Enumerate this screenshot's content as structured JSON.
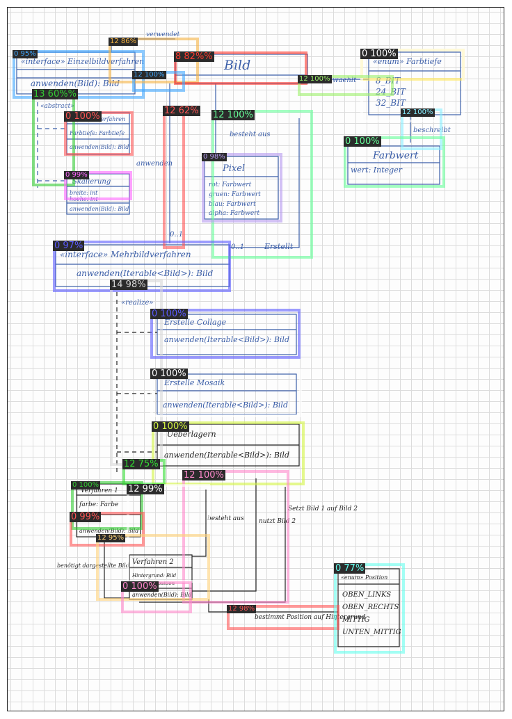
{
  "colors": {
    "ink": "#3b5ea8",
    "pen": "#222222"
  },
  "diagram": {
    "classes": [
      {
        "id": "einzelbild",
        "stereotype": "«interface» Einzelbildverfahren",
        "methods": [
          "anwenden(Bild): Bild"
        ]
      },
      {
        "id": "bild",
        "name": "Bild"
      },
      {
        "id": "farbtiefe",
        "stereotype": "«enum» Farbtiefe",
        "literals": [
          "8_BIT",
          "24_BIT",
          "32_BIT"
        ]
      },
      {
        "id": "farbwert",
        "name": "Farbwert",
        "attributes": [
          "wert: Integer"
        ]
      },
      {
        "id": "pixel",
        "name": "Pixel",
        "attributes": [
          "rot: Farbwert",
          "gruen: Farbwert",
          "blau: Farbwert",
          "alpha: Farbwert"
        ]
      },
      {
        "id": "einzelverf",
        "lines": [
          "«abstract»",
          "Einzelbildverfahren",
          "Farbtiefe: Farbtiefe",
          "anwenden(Bild): Bild"
        ]
      },
      {
        "id": "skalierung",
        "name": "Skalierung",
        "attributes": [
          "breite: int",
          "hoehe: int"
        ],
        "methods": [
          "anwenden(Bild): Bild"
        ]
      },
      {
        "id": "mehrbild",
        "stereotype": "«interface» Mehrbildverfahren",
        "methods": [
          "anwenden(Iterable<Bild>): Bild"
        ]
      },
      {
        "id": "collage",
        "name": "Erstelle Collage",
        "methods": [
          "anwenden(Iterable<Bild>): Bild"
        ]
      },
      {
        "id": "mosaik",
        "name": "Erstelle Mosaik",
        "methods": [
          "anwenden(Iterable<Bild>): Bild"
        ]
      },
      {
        "id": "ueberlagern",
        "name": "Ueberlagern",
        "methods": [
          "anwenden(Iterable<Bild>): Bild"
        ]
      },
      {
        "id": "verfahren1",
        "name": "Verfahren 1",
        "attributes": [
          "farbe: Farbe"
        ],
        "methods": [
          "anwenden(Bild): Bild"
        ]
      },
      {
        "id": "verfahren2",
        "name": "Verfahren 2",
        "attributes": [
          "Hintergrund: Bild",
          "position: Position"
        ],
        "methods": [
          "anwenden(Bild): Bild"
        ]
      },
      {
        "id": "position",
        "stereotype": "«enum» Position",
        "literals": [
          "OBEN_LINKS",
          "OBEN_RECHTS",
          "MITTIG",
          "UNTEN_MITTIG"
        ]
      }
    ],
    "labels": {
      "verwendet": "verwendet",
      "waehlt": "waehlt",
      "beschreibt": "beschreibt",
      "besteht_aus": "besteht aus",
      "anwenden": "anwenden",
      "realize": "«realize»",
      "erstellt_1": "Erstellt",
      "erstellt_2": "Erstellt",
      "mult_01": "0..1",
      "mult_01b": "0..1",
      "mult_1": "1",
      "besteht_aus_2": "besteht aus",
      "nutzt": "nutzt Bild 2",
      "setzt": "Setzt Bild 1 auf Bild 2",
      "bestimmt": "bestimmt Position auf Hintergrund",
      "benoetigt": "benötigt dargestellte Bild"
    }
  },
  "detections": [
    {
      "label": "0 95%",
      "color": "#3fa7ff"
    },
    {
      "label": "12 86%",
      "color": "#f5b342"
    },
    {
      "label": "8 82%%",
      "color": "#ff3b2f"
    },
    {
      "label": "12 100%",
      "color": "#3fa7ff"
    },
    {
      "label": "0 40%",
      "color": "#ffe85c"
    },
    {
      "label": "0 100%",
      "color": "#ffffff"
    },
    {
      "label": "12 100%",
      "color": "#9cf06a"
    },
    {
      "label": "12 100%",
      "color": "#88eeff"
    },
    {
      "label": "13 60%%",
      "color": "#33cc33"
    },
    {
      "label": "0 100%",
      "color": "#ff5555"
    },
    {
      "label": "12 62%",
      "color": "#ff5555"
    },
    {
      "label": "12 100%",
      "color": "#66ff99"
    },
    {
      "label": "0 100%",
      "color": "#66ff99"
    },
    {
      "label": "0 98%",
      "color": "#b59af0"
    },
    {
      "label": "0 99%",
      "color": "#ff66ff"
    },
    {
      "label": "0 97%",
      "color": "#5b5bff"
    },
    {
      "label": "14 98%",
      "color": "#d8d8d8"
    },
    {
      "label": "0 100%",
      "color": "#5b5bff"
    },
    {
      "label": "0 100%",
      "color": "#ffffff"
    },
    {
      "label": "0 100%",
      "color": "#d4f542"
    },
    {
      "label": "12 75%",
      "color": "#33dd33"
    },
    {
      "label": "12 100%",
      "color": "#ff88cc"
    },
    {
      "label": "0 100%",
      "color": "#33cc33"
    },
    {
      "label": "12 99%",
      "color": "#ffffff"
    },
    {
      "label": "0 99%",
      "color": "#ff5555"
    },
    {
      "label": "12 95%",
      "color": "#ffd27a"
    },
    {
      "label": "0 100%",
      "color": "#ff88cc"
    },
    {
      "label": "12 98%",
      "color": "#ff5555"
    },
    {
      "label": "0 77%",
      "color": "#66ffee"
    }
  ]
}
